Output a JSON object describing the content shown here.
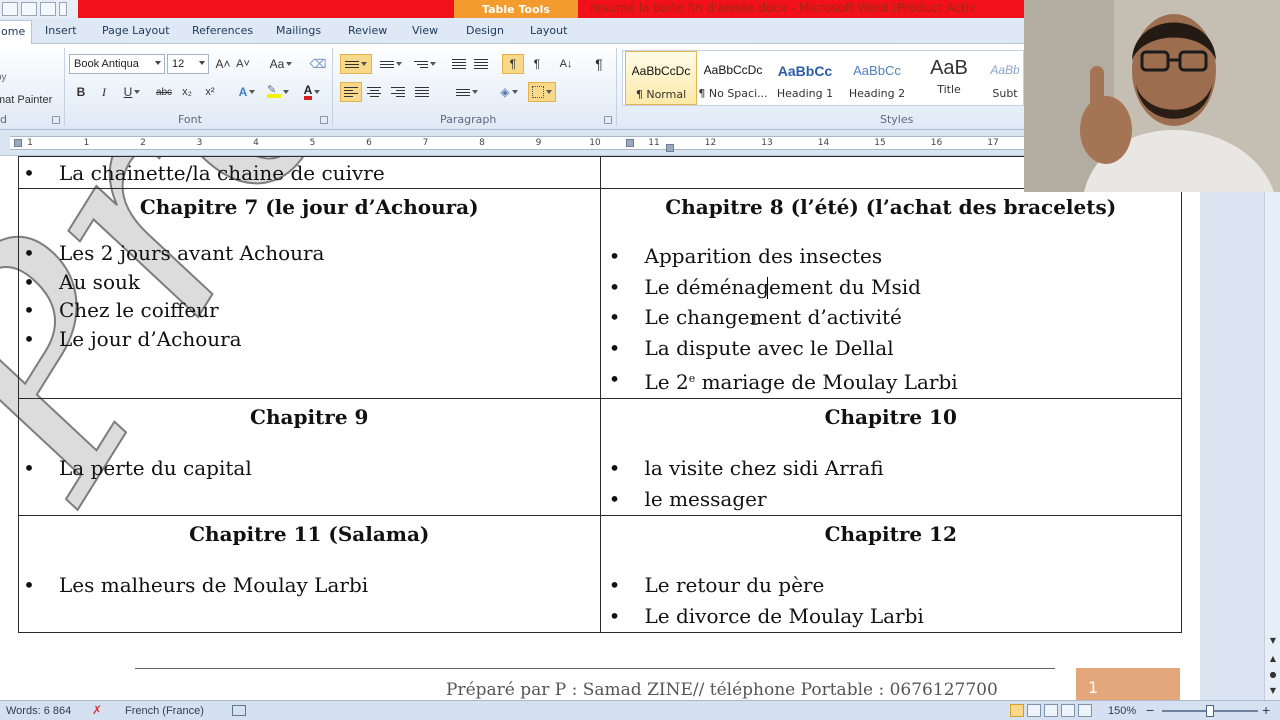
{
  "title_bar": {
    "contextual_tab": "Table Tools",
    "document_title": "resumé la boite fin d'année.docx - Microsoft Word (Product Activ"
  },
  "tabs": {
    "home": "ome",
    "insert": "Insert",
    "page_layout": "Page Layout",
    "references": "References",
    "mailings": "Mailings",
    "review": "Review",
    "view": "View",
    "design": "Design",
    "layout": "Layout"
  },
  "ribbon": {
    "clipboard": {
      "copy": "oy",
      "format_painter": "mat Painter",
      "group": "d"
    },
    "font": {
      "font_name": "Book Antiqua",
      "font_size": "12",
      "grow": "A˄",
      "shrink": "A˅",
      "change_case": "Aa",
      "bold": "B",
      "italic": "I",
      "underline": "U",
      "strikethrough": "abc",
      "subscript": "x₂",
      "superscript": "x²",
      "group": "Font"
    },
    "paragraph": {
      "group": "Paragraph",
      "pilcrow": "¶",
      "sort": "A↓"
    },
    "styles": {
      "items": [
        {
          "sample": "AaBbCcDc",
          "name": "¶ Normal"
        },
        {
          "sample": "AaBbCcDc",
          "name": "¶ No Spaci..."
        },
        {
          "sample": "AaBbCc",
          "name": "Heading 1"
        },
        {
          "sample": "AaBbCc",
          "name": "Heading 2"
        },
        {
          "sample": "AaB",
          "name": "Title"
        },
        {
          "sample": "AaBb",
          "name": "Subt"
        }
      ],
      "group": "Styles"
    }
  },
  "ruler": {
    "numbers_left": [
      "1",
      "1",
      "2",
      "3",
      "4",
      "5",
      "6",
      "7",
      "8",
      "9",
      "10"
    ],
    "numbers_right": [
      "11",
      "12",
      "13",
      "14",
      "15",
      "16",
      "17"
    ]
  },
  "document": {
    "top_row": {
      "left_item": "La chainette/la chaine de cuivre"
    },
    "rows": [
      {
        "left": {
          "title": "Chapitre 7 (le jour d’Achoura)",
          "items": [
            "Les 2 jours avant Achoura",
            "Au souk",
            "Chez le coiffeur",
            "Le jour d’Achoura"
          ]
        },
        "right": {
          "title": "Chapitre 8 (l’été) (l’achat des bracelets)",
          "items": [
            "Apparition des insectes",
            "Le déménagement du Msid",
            "Le changement d’activité",
            "La dispute avec le Dellal"
          ],
          "special_item": {
            "before": "Le 2",
            "sup": "e",
            "after": " mariage de Moulay Larbi"
          }
        }
      },
      {
        "left": {
          "title": "Chapitre 9",
          "items": [
            "La perte du capital"
          ]
        },
        "right": {
          "title": "Chapitre 10",
          "items": [
            "la visite chez sidi Arrafi",
            "le messager"
          ]
        }
      },
      {
        "left": {
          "title": "Chapitre 11 (Salama)",
          "items": [
            "Les malheurs de Moulay Larbi"
          ]
        },
        "right": {
          "title": "Chapitre 12",
          "items": [
            "Le retour du père",
            "Le divorce de Moulay Larbi"
          ]
        }
      }
    ],
    "watermark": "Proj",
    "footer": "Préparé par P : Samad ZINE// téléphone Portable : 0676127700",
    "page_number": "1"
  },
  "status_bar": {
    "words": "Words: 6 864",
    "language": "French (France)",
    "zoom": "150%",
    "zoom_minus": "−",
    "zoom_plus": "+",
    "zoom_level": 0.5
  }
}
